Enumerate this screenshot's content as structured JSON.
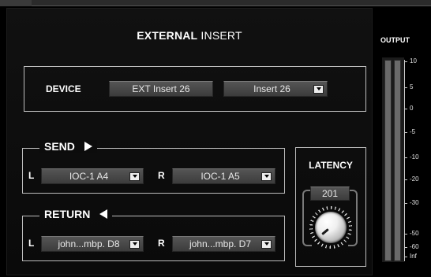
{
  "header": {
    "title_bold": "EXTERNAL",
    "title_light": "INSERT"
  },
  "device": {
    "label": "DEVICE",
    "name_field": "EXT Insert 26",
    "insert_select": "Insert 26"
  },
  "send": {
    "label": "SEND",
    "left_label": "L",
    "left_value": "IOC-1 A4",
    "right_label": "R",
    "right_value": "IOC-1 A5"
  },
  "return": {
    "label": "RETURN",
    "left_label": "L",
    "left_value": "john...mbp. D8",
    "right_label": "R",
    "right_value": "john...mbp. D7"
  },
  "latency": {
    "label": "LATENCY",
    "value": "201"
  },
  "output": {
    "label": "OUTPUT",
    "scale": [
      "10",
      "5",
      "0",
      "-5",
      "-10",
      "-20",
      "-30",
      "-50",
      "-60",
      "Inf"
    ]
  }
}
